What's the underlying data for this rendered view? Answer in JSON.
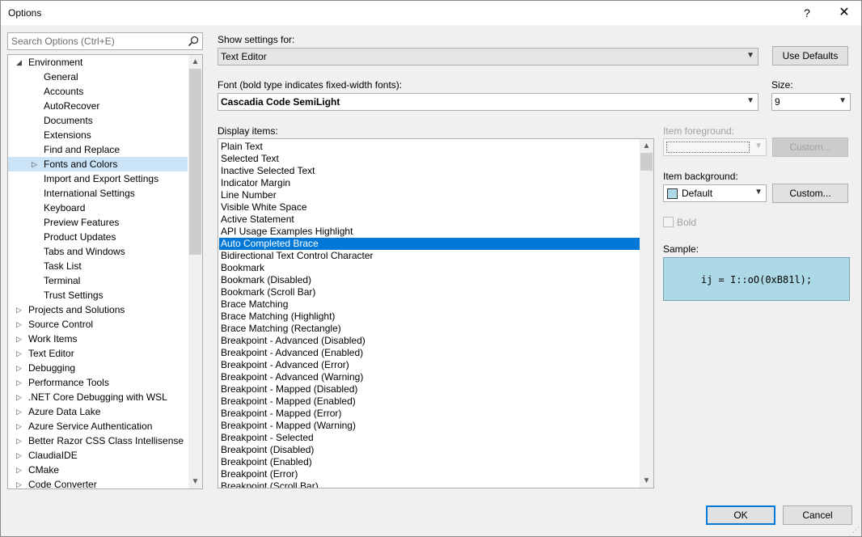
{
  "window": {
    "title": "Options",
    "help": "?",
    "close": "✕"
  },
  "search": {
    "placeholder": "Search Options (Ctrl+E)",
    "icon": "search-icon"
  },
  "tree": {
    "items": [
      {
        "label": "Environment",
        "level": 0,
        "expander": "expanded"
      },
      {
        "label": "General",
        "level": 1,
        "expander": "none"
      },
      {
        "label": "Accounts",
        "level": 1,
        "expander": "none"
      },
      {
        "label": "AutoRecover",
        "level": 1,
        "expander": "none"
      },
      {
        "label": "Documents",
        "level": 1,
        "expander": "none"
      },
      {
        "label": "Extensions",
        "level": 1,
        "expander": "none"
      },
      {
        "label": "Find and Replace",
        "level": 1,
        "expander": "none"
      },
      {
        "label": "Fonts and Colors",
        "level": 1,
        "expander": "collapsed",
        "selected": true
      },
      {
        "label": "Import and Export Settings",
        "level": 1,
        "expander": "none"
      },
      {
        "label": "International Settings",
        "level": 1,
        "expander": "none"
      },
      {
        "label": "Keyboard",
        "level": 1,
        "expander": "none"
      },
      {
        "label": "Preview Features",
        "level": 1,
        "expander": "none"
      },
      {
        "label": "Product Updates",
        "level": 1,
        "expander": "none"
      },
      {
        "label": "Tabs and Windows",
        "level": 1,
        "expander": "none"
      },
      {
        "label": "Task List",
        "level": 1,
        "expander": "none"
      },
      {
        "label": "Terminal",
        "level": 1,
        "expander": "none"
      },
      {
        "label": "Trust Settings",
        "level": 1,
        "expander": "none"
      },
      {
        "label": "Projects and Solutions",
        "level": 0,
        "expander": "collapsed"
      },
      {
        "label": "Source Control",
        "level": 0,
        "expander": "collapsed"
      },
      {
        "label": "Work Items",
        "level": 0,
        "expander": "collapsed"
      },
      {
        "label": "Text Editor",
        "level": 0,
        "expander": "collapsed"
      },
      {
        "label": "Debugging",
        "level": 0,
        "expander": "collapsed"
      },
      {
        "label": "Performance Tools",
        "level": 0,
        "expander": "collapsed"
      },
      {
        "label": ".NET Core Debugging with WSL",
        "level": 0,
        "expander": "collapsed"
      },
      {
        "label": "Azure Data Lake",
        "level": 0,
        "expander": "collapsed"
      },
      {
        "label": "Azure Service Authentication",
        "level": 0,
        "expander": "collapsed"
      },
      {
        "label": "Better Razor CSS Class Intellisense",
        "level": 0,
        "expander": "collapsed"
      },
      {
        "label": "ClaudiaIDE",
        "level": 0,
        "expander": "collapsed"
      },
      {
        "label": "CMake",
        "level": 0,
        "expander": "collapsed"
      },
      {
        "label": "Code Converter",
        "level": 0,
        "expander": "collapsed"
      }
    ]
  },
  "show_settings": {
    "label": "Show settings for:",
    "value": "Text Editor"
  },
  "use_defaults": "Use Defaults",
  "font": {
    "label": "Font (bold type indicates fixed-width fonts):",
    "value": "Cascadia Code SemiLight"
  },
  "size": {
    "label": "Size:",
    "value": "9"
  },
  "display_items": {
    "label": "Display items:",
    "items": [
      "Plain Text",
      "Selected Text",
      "Inactive Selected Text",
      "Indicator Margin",
      "Line Number",
      "Visible White Space",
      "Active Statement",
      "API Usage Examples Highlight",
      "Auto Completed Brace",
      "Bidirectional Text Control Character",
      "Bookmark",
      "Bookmark (Disabled)",
      "Bookmark (Scroll Bar)",
      "Brace Matching",
      "Brace Matching (Highlight)",
      "Brace Matching (Rectangle)",
      "Breakpoint - Advanced (Disabled)",
      "Breakpoint - Advanced (Enabled)",
      "Breakpoint - Advanced (Error)",
      "Breakpoint - Advanced (Warning)",
      "Breakpoint - Mapped (Disabled)",
      "Breakpoint - Mapped (Enabled)",
      "Breakpoint - Mapped (Error)",
      "Breakpoint - Mapped (Warning)",
      "Breakpoint - Selected",
      "Breakpoint (Disabled)",
      "Breakpoint (Enabled)",
      "Breakpoint (Error)",
      "Breakpoint (Scroll Bar)"
    ],
    "selected": "Auto Completed Brace"
  },
  "item_foreground": {
    "label": "Item foreground:",
    "button": "Custom..."
  },
  "item_background": {
    "label": "Item background:",
    "value": "Default",
    "swatch_color": "#add8e6",
    "button": "Custom..."
  },
  "bold": {
    "label": "Bold",
    "checked": false
  },
  "sample": {
    "label": "Sample:",
    "text": "ij = I::oO(0xB81l);",
    "background": "#add8e6"
  },
  "ok": "OK",
  "cancel": "Cancel",
  "colors": {
    "selection": "#0078d7",
    "tree_selection": "#cce4f7"
  }
}
